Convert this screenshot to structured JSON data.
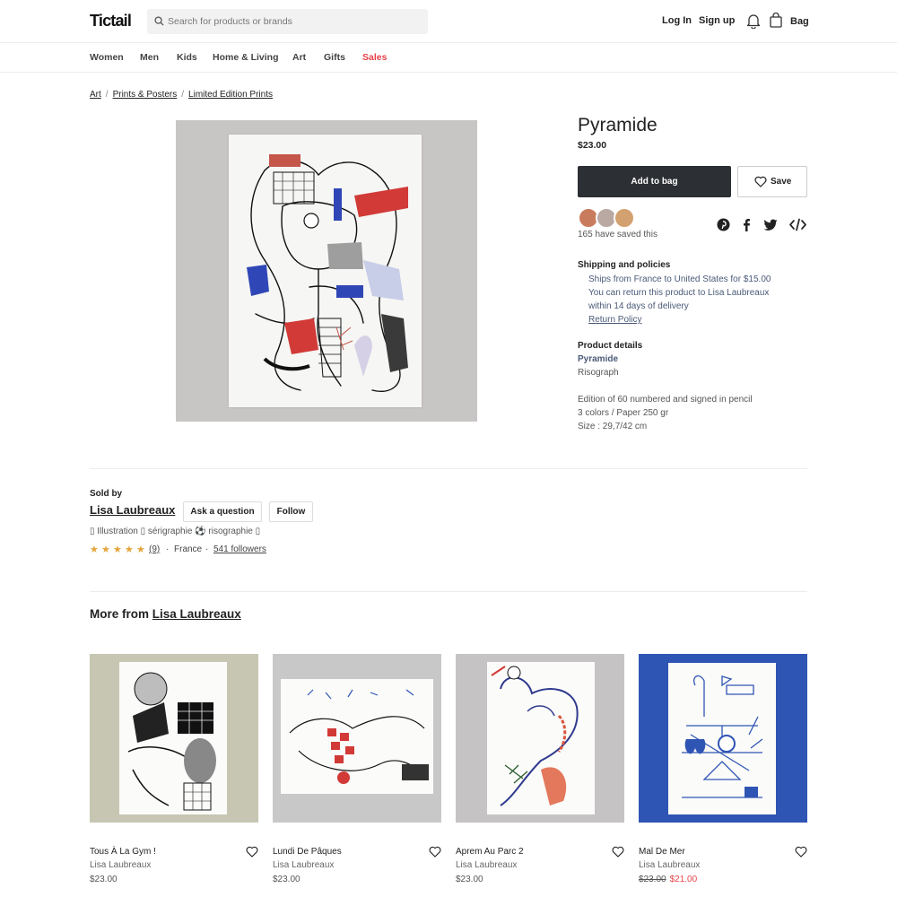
{
  "header": {
    "logo": "Tictail",
    "search_placeholder": "Search for products or brands",
    "login": "Log In",
    "signup": "Sign up",
    "bag": "Bag"
  },
  "nav": {
    "items": [
      "Women",
      "Men",
      "Kids",
      "Home & Living",
      "Art",
      "Gifts",
      "Sales"
    ],
    "sale_color": "#e8434a"
  },
  "breadcrumb": [
    "Art",
    "Prints & Posters",
    "Limited Edition Prints"
  ],
  "product": {
    "title": "Pyramide",
    "price": "$23.00",
    "add_to_bag": "Add to bag",
    "save": "Save",
    "saved_count_text": "165 have saved this",
    "shipping_title": "Shipping and policies",
    "shipping_lines": [
      "Ships from France to United States for $15.00",
      "You can return this product to Lisa Laubreaux",
      "within 14 days of delivery"
    ],
    "return_policy": "Return Policy",
    "details_title": "Product details",
    "details_name": "Pyramide",
    "details_type": "Risograph",
    "details_lines": [
      "Edition of 60 numbered and signed in pencil",
      "3 colors / Paper 250 gr",
      "Size : 29,7/42 cm"
    ]
  },
  "seller": {
    "sold_by": "Sold by",
    "name": "Lisa Laubreaux",
    "ask": "Ask a question",
    "follow": "Follow",
    "tags": "▯ Illustration ▯ sérigraphie ⚽ risographie ▯",
    "rating": 5,
    "reviews": "(9)",
    "dot": "·",
    "country": "France",
    "followers": "541 followers"
  },
  "more": {
    "prefix": "More from",
    "seller": "Lisa Laubreaux",
    "cards": [
      {
        "title": "Tous À La Gym !",
        "seller": "Lisa Laubreaux",
        "price": "$23.00",
        "sale_price": ""
      },
      {
        "title": "Lundi De Pâques",
        "seller": "Lisa Laubreaux",
        "price": "$23.00",
        "sale_price": ""
      },
      {
        "title": "Aprem Au Parc 2",
        "seller": "Lisa Laubreaux",
        "price": "$23.00",
        "sale_price": ""
      },
      {
        "title": "Mal De Mer",
        "seller": "Lisa Laubreaux",
        "price": "$23.00",
        "sale_price": "$21.00"
      }
    ]
  },
  "colors": {
    "primary_button": "#2c2f33",
    "star": "#e6a43b",
    "sale": "#e8434a",
    "blue_print": "#2f55b4"
  }
}
